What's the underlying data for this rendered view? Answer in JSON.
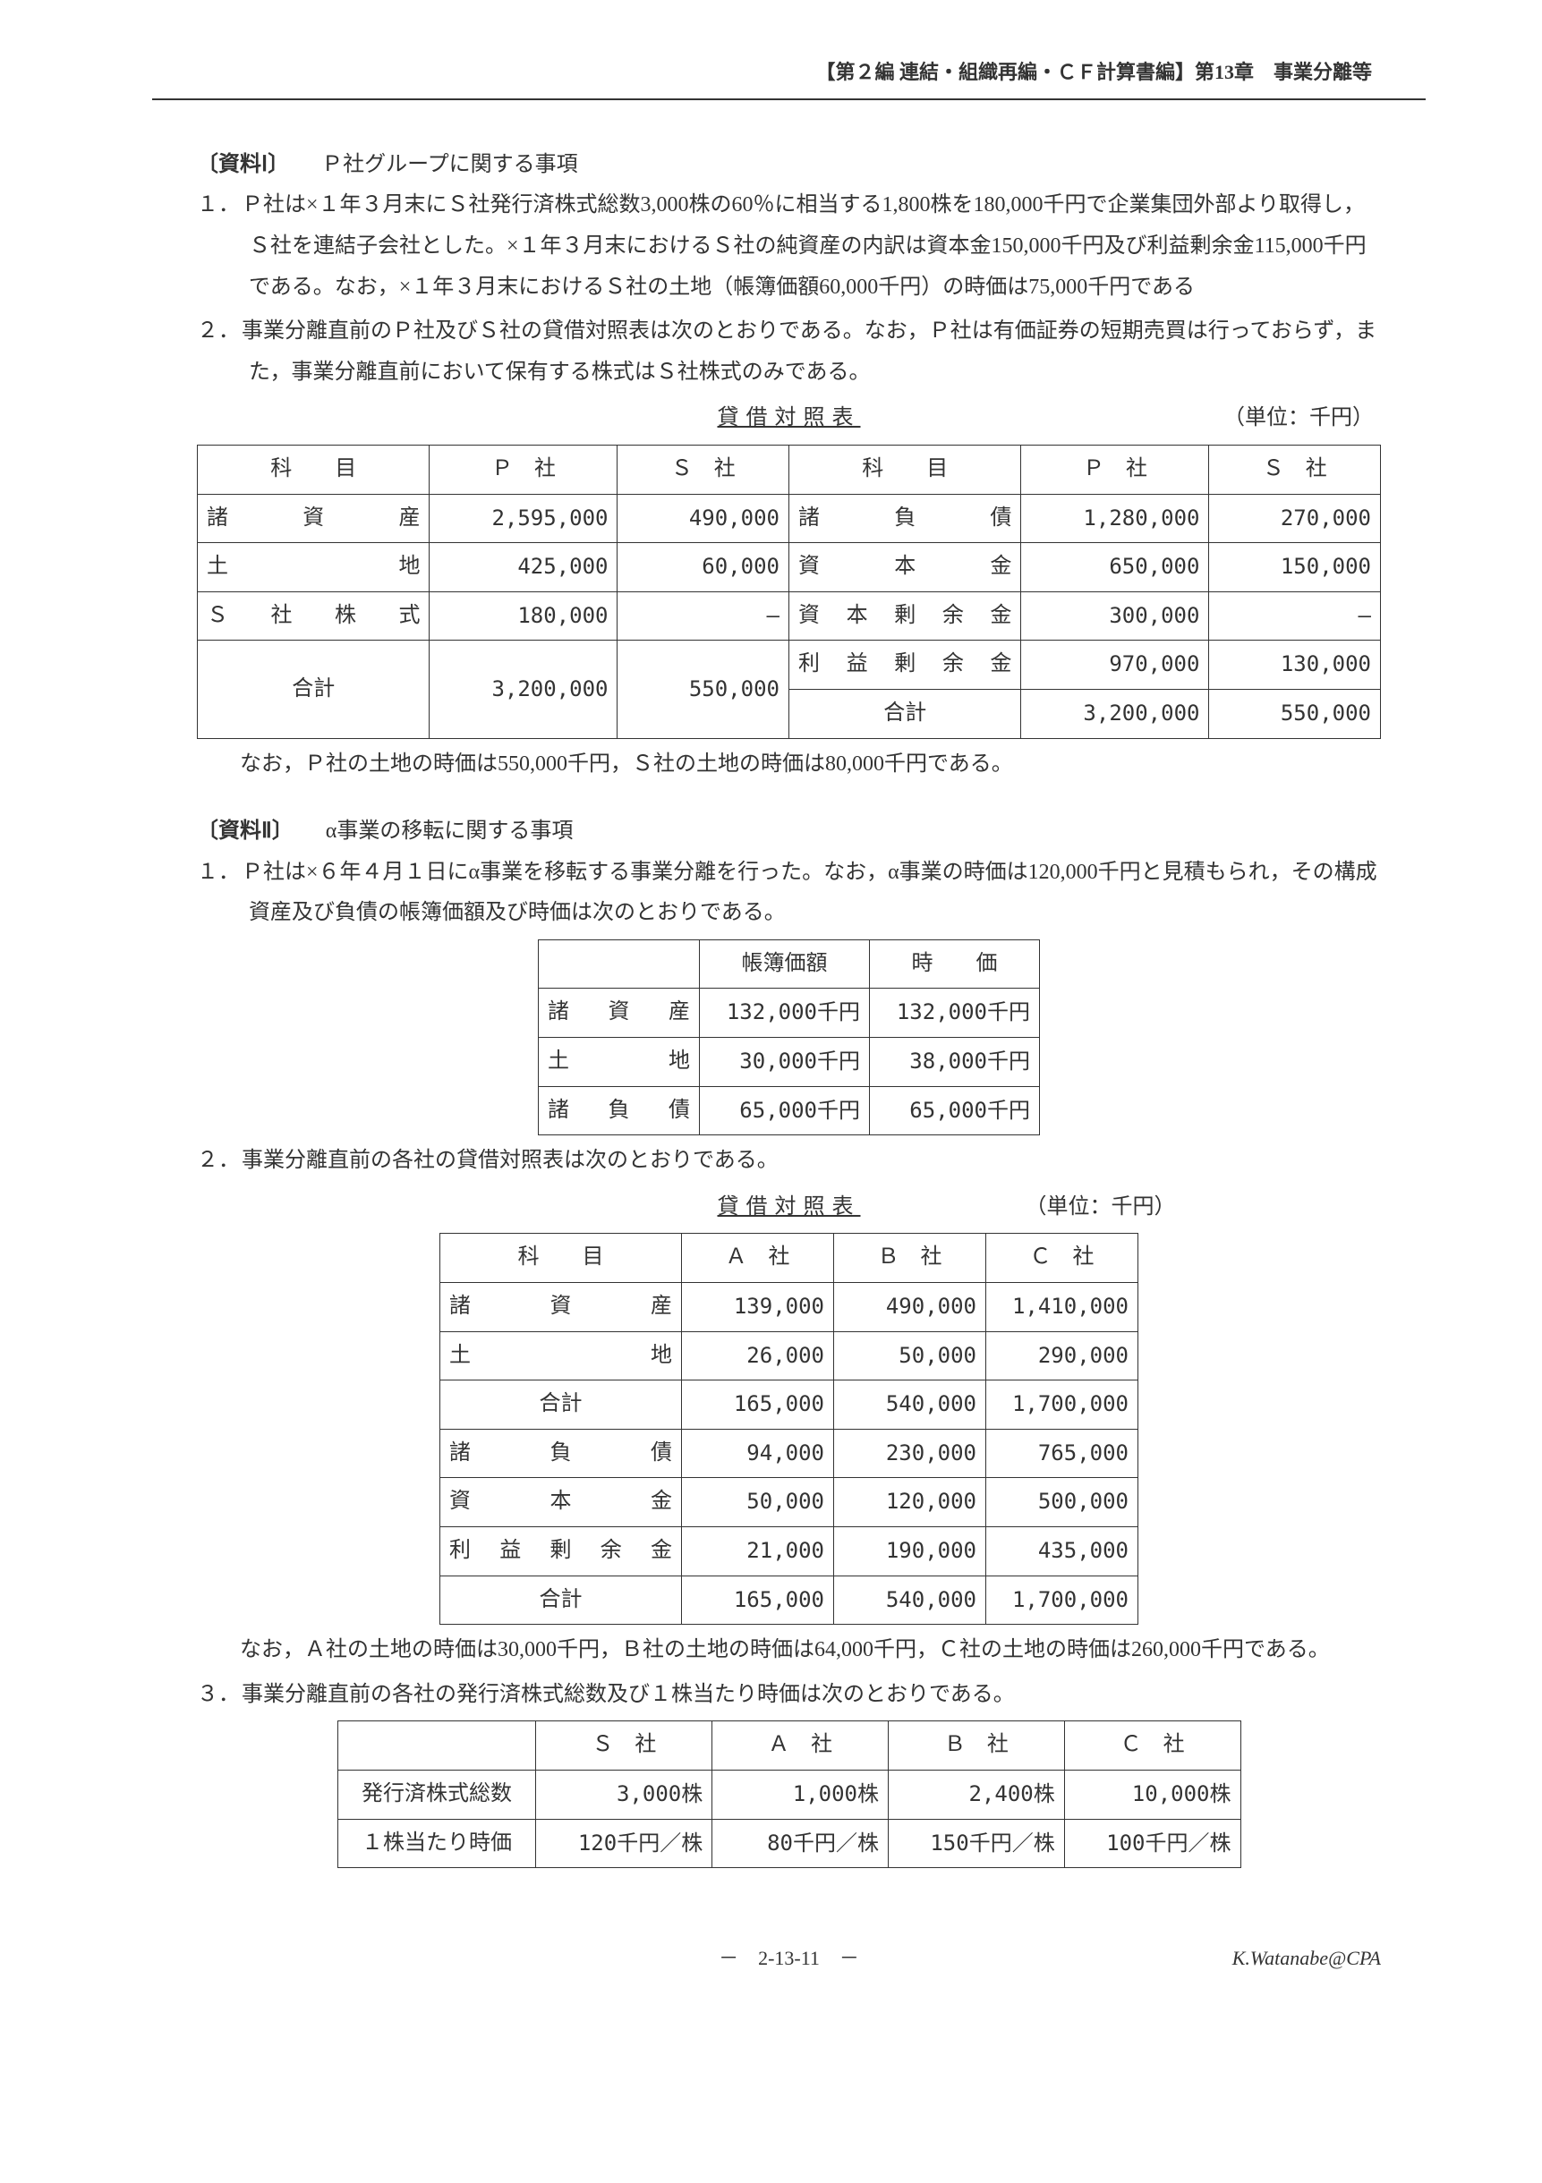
{
  "header": "【第２編 連結・組織再編・ＣＦ計算書編】第13章　事業分離等",
  "s1": {
    "title_bold": "〔資料Ⅰ〕",
    "title_rest": "　　Ｐ社グループに関する事項",
    "items": [
      "Ｐ社は×１年３月末にＳ社発行済株式総数3,000株の60％に相当する1,800株を180,000千円で企業集団外部より取得し，Ｓ社を連結子会社とした。×１年３月末におけるＳ社の純資産の内訳は資本金150,000千円及び利益剰余金115,000千円である。なお，×１年３月末におけるＳ社の土地（帳簿価額60,000千円）の時価は75,000千円である",
      "事業分離直前のＰ社及びＳ社の貸借対照表は次のとおりである。なお，Ｐ社は有価証券の短期売買は行っておらず，また，事業分離直前において保有する株式はＳ社株式のみである。"
    ]
  },
  "t1": {
    "title": "貸借対照表",
    "unit": "（単位：千円）",
    "h": {
      "kamoku": "科　　目",
      "p": "Ｐ　社",
      "s": "Ｓ　社"
    },
    "l": [
      {
        "n": "諸資産",
        "p": "2,595,000",
        "s": "490,000"
      },
      {
        "n": "土地",
        "p": "425,000",
        "s": "60,000"
      },
      {
        "n": "Ｓ社株式",
        "p": "180,000",
        "s": "—"
      }
    ],
    "r": [
      {
        "n": "諸負債",
        "p": "1,280,000",
        "s": "270,000"
      },
      {
        "n": "資本金",
        "p": "650,000",
        "s": "150,000"
      },
      {
        "n": "資本剰余金",
        "p": "300,000",
        "s": "—"
      },
      {
        "n": "利益剰余金",
        "p": "970,000",
        "s": "130,000"
      }
    ],
    "tot": {
      "n": "合計",
      "lp": "3,200,000",
      "ls": "550,000",
      "rp": "3,200,000",
      "rs": "550,000"
    },
    "note": "なお，Ｐ社の土地の時価は550,000千円，Ｓ社の土地の時価は80,000千円である。"
  },
  "s2": {
    "title_bold": "〔資料Ⅱ〕",
    "title_rest": "　　α事業の移転に関する事項",
    "i1": "Ｐ社は×６年４月１日にα事業を移転する事業分離を行った。なお，α事業の時価は120,000千円と見積もられ，その構成資産及び負債の帳簿価額及び時価は次のとおりである。",
    "i2": "事業分離直前の各社の貸借対照表は次のとおりである。",
    "i3": "事業分離直前の各社の発行済株式総数及び１株当たり時価は次のとおりである。"
  },
  "t2": {
    "h": {
      "bv": "帳簿価額",
      "fv": "時　　価"
    },
    "r": [
      {
        "n": "諸資産",
        "bv": "132,000千円",
        "fv": "132,000千円"
      },
      {
        "n": "土地",
        "bv": "30,000千円",
        "fv": "38,000千円"
      },
      {
        "n": "諸負債",
        "bv": "65,000千円",
        "fv": "65,000千円"
      }
    ]
  },
  "t3": {
    "title": "貸借対照表",
    "unit": "（単位：千円）",
    "h": {
      "kamoku": "科　　目",
      "a": "Ａ　社",
      "b": "Ｂ　社",
      "c": "Ｃ　社"
    },
    "r": [
      {
        "n": "諸資産",
        "a": "139,000",
        "b": "490,000",
        "c": "1,410,000"
      },
      {
        "n": "土地",
        "a": "26,000",
        "b": "50,000",
        "c": "290,000"
      }
    ],
    "sub": {
      "n": "合計",
      "a": "165,000",
      "b": "540,000",
      "c": "1,700,000"
    },
    "r2": [
      {
        "n": "諸負債",
        "a": "94,000",
        "b": "230,000",
        "c": "765,000"
      },
      {
        "n": "資本金",
        "a": "50,000",
        "b": "120,000",
        "c": "500,000"
      },
      {
        "n": "利益剰余金",
        "a": "21,000",
        "b": "190,000",
        "c": "435,000"
      }
    ],
    "tot": {
      "n": "合計",
      "a": "165,000",
      "b": "540,000",
      "c": "1,700,000"
    },
    "note": "なお，Ａ社の土地の時価は30,000千円，Ｂ社の土地の時価は64,000千円，Ｃ社の土地の時価は260,000千円である。"
  },
  "t4": {
    "h": {
      "s": "Ｓ　社",
      "a": "Ａ　社",
      "b": "Ｂ　社",
      "c": "Ｃ　社"
    },
    "r": [
      {
        "n": "発行済株式総数",
        "s": "3,000株",
        "a": "1,000株",
        "b": "2,400株",
        "c": "10,000株"
      },
      {
        "n": "１株当たり時価",
        "s": "120千円／株",
        "a": "80千円／株",
        "b": "150千円／株",
        "c": "100千円／株"
      }
    ]
  },
  "footer": {
    "page": "－　2-13-11　－",
    "author": "K.Watanabe@CPA"
  }
}
